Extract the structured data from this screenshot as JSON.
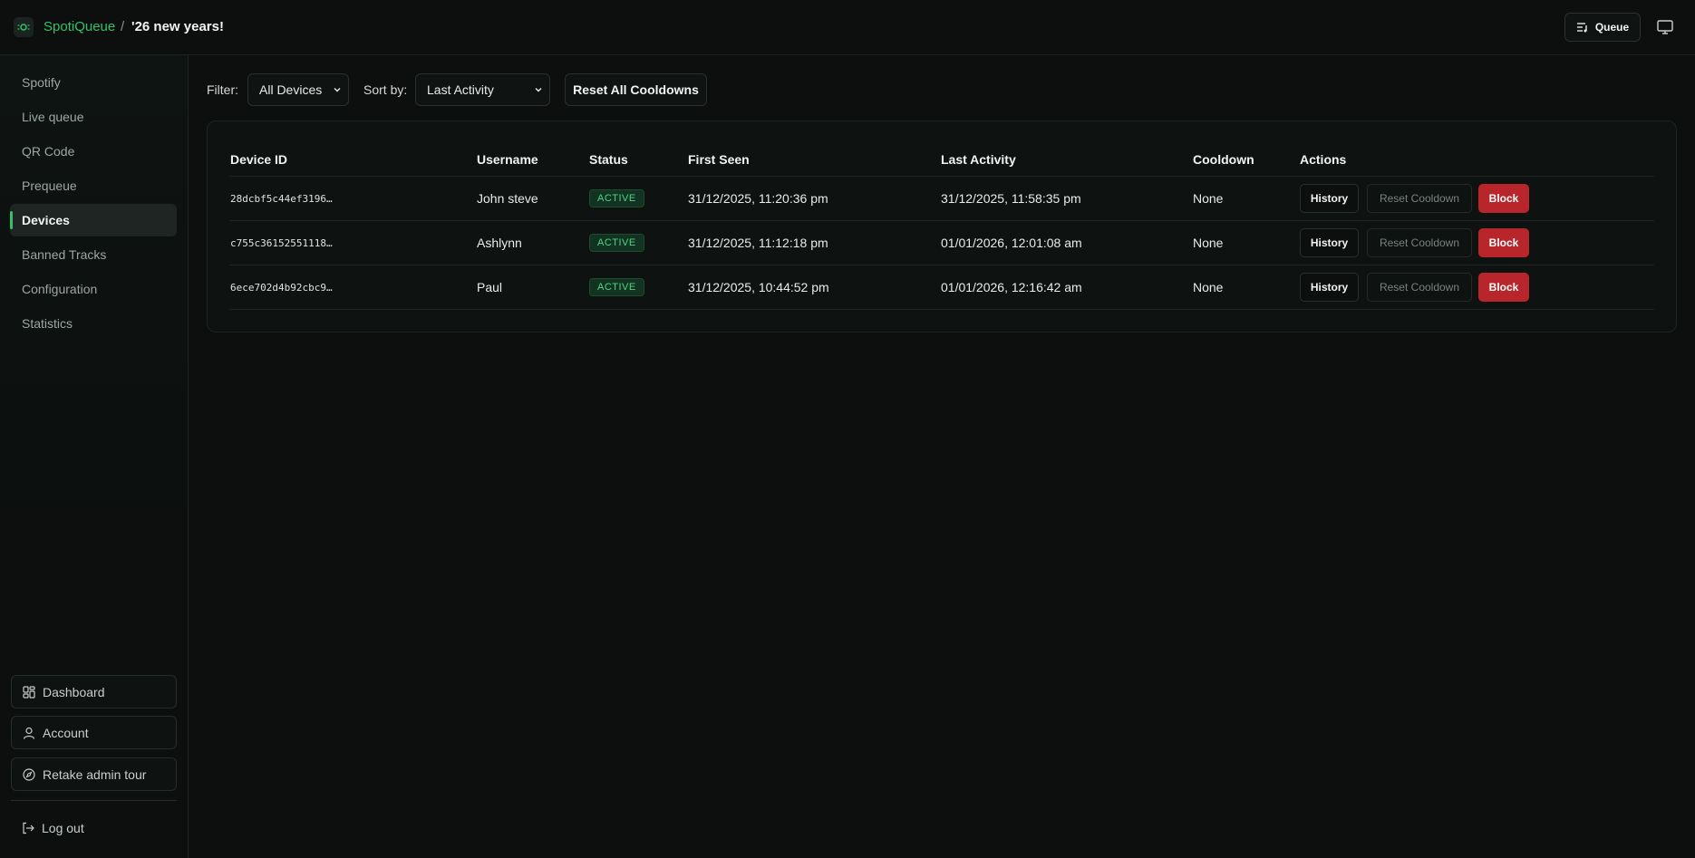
{
  "header": {
    "brand": "SpotiQueue",
    "separator": "/",
    "session_name": "'26 new years!",
    "queue_button": "Queue"
  },
  "sidebar": {
    "items": [
      {
        "label": "Spotify"
      },
      {
        "label": "Live queue"
      },
      {
        "label": "QR Code"
      },
      {
        "label": "Prequeue"
      },
      {
        "label": "Devices",
        "active": true
      },
      {
        "label": "Banned Tracks"
      },
      {
        "label": "Configuration"
      },
      {
        "label": "Statistics"
      }
    ],
    "bottom": {
      "dashboard": "Dashboard",
      "account": "Account",
      "retake_tour": "Retake admin tour",
      "logout": "Log out"
    }
  },
  "toolbar": {
    "filter_label": "Filter:",
    "filter_value": "All Devices",
    "sort_label": "Sort by:",
    "sort_value": "Last Activity",
    "reset_all": "Reset All Cooldowns"
  },
  "table": {
    "headers": [
      "Device ID",
      "Username",
      "Status",
      "First Seen",
      "Last Activity",
      "Cooldown",
      "Actions"
    ],
    "rows": [
      {
        "device_id": "28dcbf5c44ef3196…",
        "username": "John steve",
        "status": "ACTIVE",
        "first_seen": "31/12/2025, 11:20:36 pm",
        "last_activity": "31/12/2025, 11:58:35 pm",
        "cooldown": "None"
      },
      {
        "device_id": "c755c36152551118…",
        "username": "Ashlynn",
        "status": "ACTIVE",
        "first_seen": "31/12/2025, 11:12:18 pm",
        "last_activity": "01/01/2026, 12:01:08 am",
        "cooldown": "None"
      },
      {
        "device_id": "6ece702d4b92cbc9…",
        "username": "Paul",
        "status": "ACTIVE",
        "first_seen": "31/12/2025, 10:44:52 pm",
        "last_activity": "01/01/2026, 12:16:42 am",
        "cooldown": "None"
      }
    ],
    "actions": {
      "history": "History",
      "reset_cooldown": "Reset Cooldown",
      "block": "Block"
    }
  },
  "colors": {
    "accent": "#35c06a",
    "block": "#b8262b",
    "background": "#0c0f0e"
  }
}
